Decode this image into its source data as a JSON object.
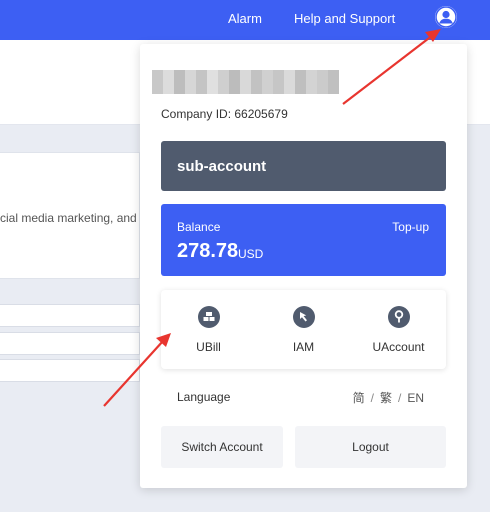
{
  "topbar": {
    "alarm_label": "Alarm",
    "help_label": "Help and Support",
    "avatar_icon": "user-icon"
  },
  "background": {
    "card_text": "cial media marketing, and"
  },
  "dropdown": {
    "company_id": "Company ID: 66205679",
    "subaccount_label": "sub-account",
    "balance": {
      "label": "Balance",
      "topup_label": "Top-up",
      "amount": "278.78",
      "unit": "USD"
    },
    "shortcuts": [
      {
        "label": "UBill",
        "icon": "bill-icon"
      },
      {
        "label": "IAM",
        "icon": "cursor-icon"
      },
      {
        "label": "UAccount",
        "icon": "key-icon"
      }
    ],
    "language": {
      "label": "Language",
      "options": [
        "简",
        "繁",
        "EN"
      ],
      "separator": "/"
    },
    "switch_account_label": "Switch Account",
    "logout_label": "Logout"
  },
  "colors": {
    "brand_blue": "#3d5ff3",
    "dark_slate": "#505b6e",
    "annotation_red": "#e8352f"
  }
}
